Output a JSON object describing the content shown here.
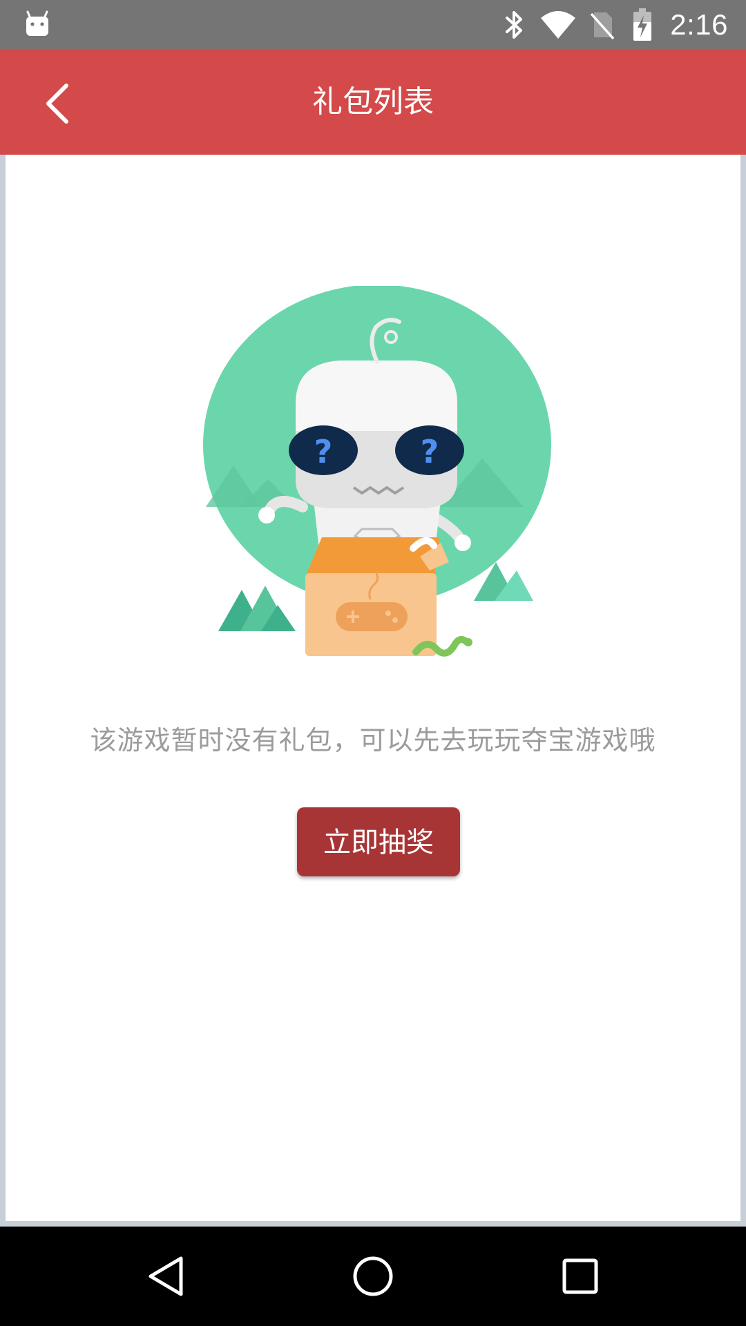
{
  "status_bar": {
    "time": "2:16",
    "icons": [
      "android-icon",
      "bluetooth-icon",
      "wifi-icon",
      "no-sim-icon",
      "battery-charging-icon"
    ]
  },
  "app_bar": {
    "title": "礼包列表",
    "back_icon": "chevron-left-icon"
  },
  "empty_state": {
    "message": "该游戏暂时没有礼包，可以先去玩玩夺宝游戏哦",
    "button_label": "立即抽奖",
    "illustration": "robot-in-box-illustration"
  },
  "nav_bar": {
    "icons": [
      "back-triangle-icon",
      "home-circle-icon",
      "recents-square-icon"
    ]
  },
  "colors": {
    "app_bar": "#d4494a",
    "status_bar": "#757575",
    "button": "#a83536",
    "message_text": "#9b9b9b",
    "circle": "#6bd6ac"
  }
}
